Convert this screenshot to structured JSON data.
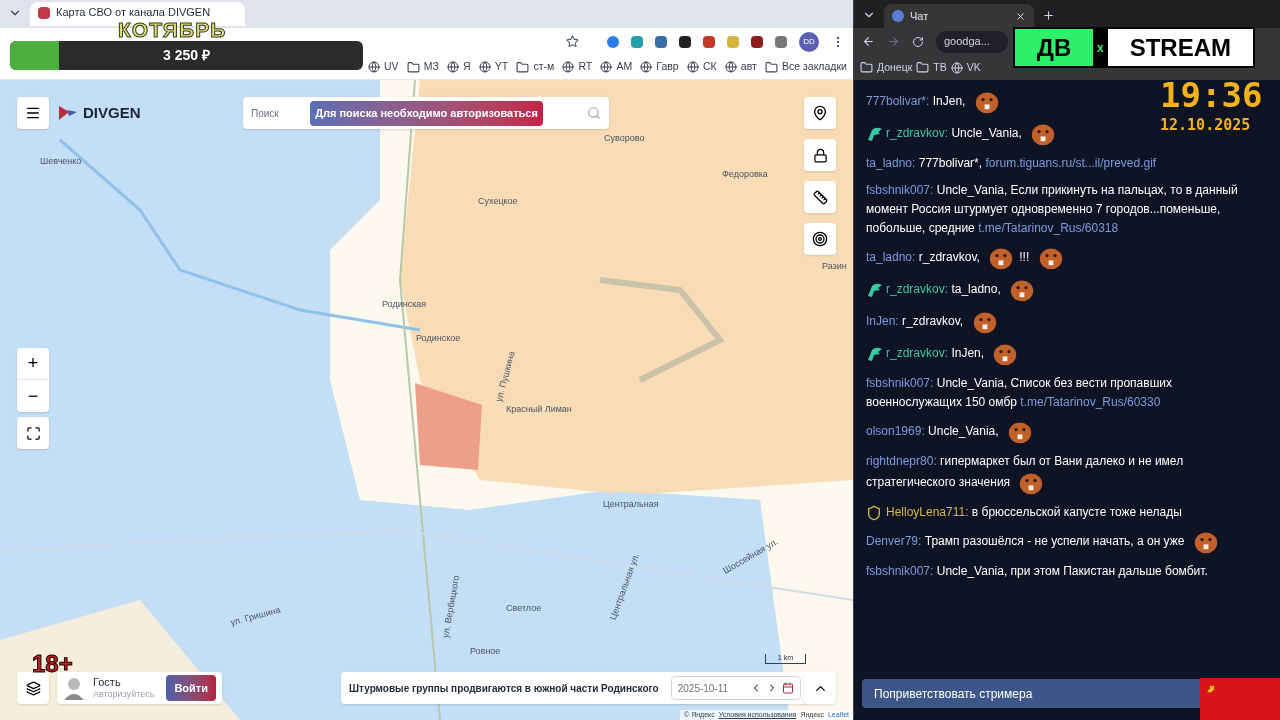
{
  "map_browser": {
    "tab_title": "Карта СВО от канала DIVGEN",
    "bookmarks": [
      {
        "kind": "site",
        "label": "UV"
      },
      {
        "kind": "folder",
        "label": "МЗ"
      },
      {
        "kind": "site",
        "label": "Я"
      },
      {
        "kind": "site",
        "label": "YT"
      },
      {
        "kind": "folder",
        "label": "ст-м"
      },
      {
        "kind": "site",
        "label": "RT"
      },
      {
        "kind": "site",
        "label": "AM"
      },
      {
        "kind": "site",
        "label": "Гавр"
      },
      {
        "kind": "site",
        "label": "СК"
      },
      {
        "kind": "site",
        "label": "авт"
      },
      {
        "kind": "folder",
        "label": "Все закладки"
      }
    ],
    "profile": "DD"
  },
  "map": {
    "logo": "DIVGEN",
    "search": {
      "placeholder": "Поиск"
    },
    "auth_notice": "Для поиска необходимо авторизоваться",
    "places": [
      "Шевченко",
      "Суворово",
      "Федоровка",
      "Сухецкое",
      "Разин",
      "Родинская",
      "Родинское",
      "ул. Пушкина",
      "Красный Лиман",
      "Центральная",
      "Шоссейная ул.",
      "Светлое",
      "Ровное",
      "ул. Гришина",
      "ул. Вербицкого",
      "Центральная ул."
    ],
    "zoom_in": "+",
    "zoom_out": "−",
    "user": {
      "name": "Гость",
      "hint": "Авторизуйтесь",
      "login": "Войти"
    },
    "news": {
      "headline": "Штурмовые группы продвигаются в южной части Родинского",
      "date": "2025-10-11"
    },
    "scale": "1 km",
    "attribution": {
      "copyright": "© Яндекс",
      "terms": "Условия использования",
      "brand": "Яндекс",
      "engine": "Leaflet"
    }
  },
  "chat_browser": {
    "tab_title": "Чат",
    "url": "goodga...",
    "bookmarks": [
      {
        "kind": "folder",
        "label": "Донецк"
      },
      {
        "kind": "folder",
        "label": "ТВ"
      },
      {
        "kind": "site",
        "label": "VK"
      }
    ]
  },
  "chat": {
    "messages": [
      {
        "user": "777bolivar*:",
        "color": "#7b9be0",
        "parts": [
          {
            "kind": "text",
            "text": "InJen,"
          },
          {
            "kind": "emote"
          }
        ]
      },
      {
        "user": "r_zdravkov:",
        "color": "#3fc6a6",
        "badge": {
          "kind": "eagle"
        },
        "parts": [
          {
            "kind": "text",
            "text": "Uncle_Vania,"
          },
          {
            "kind": "emote"
          }
        ]
      },
      {
        "user": "ta_ladno:",
        "color": "#7b9be0",
        "parts": [
          {
            "kind": "text",
            "text": "777bolivar*,"
          },
          {
            "kind": "link",
            "text": "forum.tiguans.ru/st...il/preved.gif"
          }
        ]
      },
      {
        "user": "fsbshnik007:",
        "color": "#7b9be0",
        "parts": [
          {
            "kind": "text",
            "text": "Uncle_Vania, Если прикинуть на пальцах, то в данный момент Россия штурмует одновременно 7 городов...поменьше, побольше, средние"
          },
          {
            "kind": "link",
            "text": "t.me/Tatarinov_Rus/60318"
          }
        ]
      },
      {
        "user": "ta_ladno:",
        "color": "#7b9be0",
        "parts": [
          {
            "kind": "text",
            "text": "r_zdravkov,"
          },
          {
            "kind": "emote"
          },
          {
            "kind": "text",
            "text": "!!!"
          },
          {
            "kind": "emote"
          }
        ]
      },
      {
        "user": "r_zdravkov:",
        "color": "#3fc6a6",
        "badge": {
          "kind": "eagle"
        },
        "parts": [
          {
            "kind": "text",
            "text": "ta_ladno,"
          },
          {
            "kind": "emote"
          }
        ]
      },
      {
        "user": "InJen:",
        "color": "#7b9be0",
        "parts": [
          {
            "kind": "text",
            "text": "r_zdravkov,"
          },
          {
            "kind": "emote"
          }
        ]
      },
      {
        "user": "r_zdravkov:",
        "color": "#3fc6a6",
        "badge": {
          "kind": "eagle"
        },
        "parts": [
          {
            "kind": "text",
            "text": "InJen,"
          },
          {
            "kind": "emote"
          }
        ]
      },
      {
        "user": "fsbshnik007:",
        "color": "#7b9be0",
        "parts": [
          {
            "kind": "text",
            "text": "Uncle_Vania, Список без вести пропавших военнослужащих 150 омбр"
          },
          {
            "kind": "link",
            "text": "t.me/Tatarinov_Rus/60330"
          }
        ]
      },
      {
        "user": "olson1969:",
        "color": "#7b9be0",
        "parts": [
          {
            "kind": "text",
            "text": "Uncle_Vania,"
          },
          {
            "kind": "emote"
          }
        ]
      },
      {
        "user": "rightdnepr80:",
        "color": "#7b9be0",
        "parts": [
          {
            "kind": "text",
            "text": "гипермаркет был от Вани далеко и не имел стратегического значения"
          },
          {
            "kind": "emote"
          }
        ]
      },
      {
        "user": "HelloyLena711:",
        "color": "#d6b845",
        "badge": {
          "kind": "shield"
        },
        "parts": [
          {
            "kind": "text",
            "text": "в брюссельской капусте тоже нелады"
          }
        ]
      },
      {
        "user": "Denver79:",
        "color": "#7b9be0",
        "parts": [
          {
            "kind": "text",
            "text": "Трамп разошёлся - не успели начать, а он уже"
          },
          {
            "kind": "emote"
          }
        ]
      },
      {
        "user": "fsbshnik007:",
        "color": "#7b9be0",
        "parts": [
          {
            "kind": "text",
            "text": "Uncle_Vania, при этом Пакистан дальше бомбит."
          }
        ]
      }
    ],
    "greet_button": "Поприветствовать стримера"
  },
  "overlay": {
    "month": "КОТЯБРЬ",
    "donation": {
      "amount": "3 250 ₽",
      "level": 0.14
    },
    "age": "18+",
    "logo": {
      "left": "ДB",
      "joiner": "x",
      "right": "STREAM"
    },
    "clock": "19:36",
    "date": "12.10.2025"
  }
}
